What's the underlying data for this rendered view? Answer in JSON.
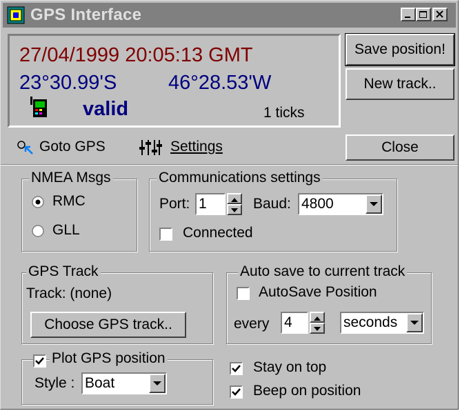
{
  "window": {
    "title": "GPS Interface"
  },
  "status": {
    "datetime": "27/04/1999 20:05:13 GMT",
    "latitude": "23°30.99'S",
    "longitude": "46°28.53'W",
    "fix": "valid",
    "ticks": "1 ticks"
  },
  "buttons": {
    "save_position": "Save position!",
    "new_track": "New track..",
    "close": "Close",
    "choose_track": "Choose GPS track.."
  },
  "toolbar": {
    "goto_gps": "Goto GPS",
    "settings": "Settings"
  },
  "nmea": {
    "label": "NMEA Msgs",
    "options": [
      "RMC",
      "GLL"
    ],
    "selected": "RMC"
  },
  "comms": {
    "label": "Communications settings",
    "port_label": "Port:",
    "port_value": "1",
    "baud_label": "Baud:",
    "baud_value": "4800",
    "connected_label": "Connected",
    "connected": false
  },
  "track": {
    "label": "GPS Track",
    "current": "Track: (none)"
  },
  "autosave": {
    "label": "Auto save to current track",
    "checkbox_label": "AutoSave Position",
    "checked": false,
    "every_label": "every",
    "interval_value": "4",
    "unit_value": "seconds"
  },
  "plot": {
    "checkbox_label": "Plot GPS position",
    "checked": true,
    "style_label": "Style :",
    "style_value": "Boat"
  },
  "options": {
    "stay_on_top": "Stay on top",
    "stay_on_top_checked": true,
    "beep": "Beep on position",
    "beep_checked": true
  }
}
